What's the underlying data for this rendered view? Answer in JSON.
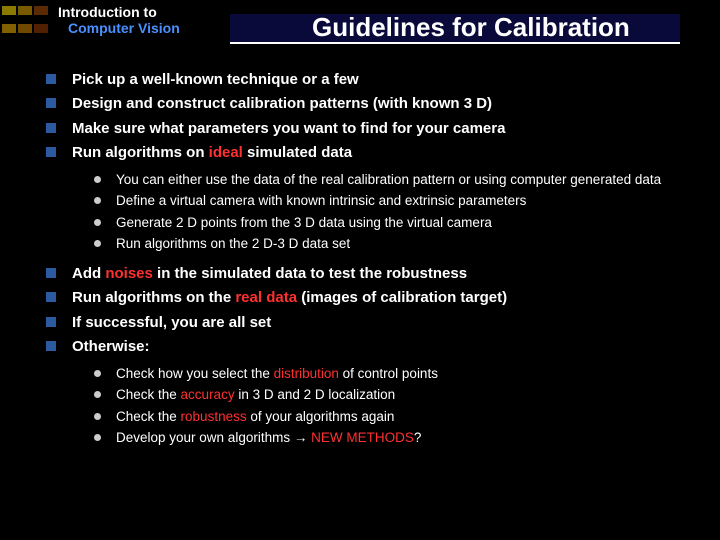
{
  "header": {
    "intro_line1": "Introduction to",
    "intro_line2": "Computer Vision",
    "title": "Guidelines for Calibration"
  },
  "bullets1": [
    {
      "pre": "Pick up a well-known technique or a few"
    },
    {
      "pre": "Design and construct calibration patterns (with known 3 D)"
    },
    {
      "pre": "Make sure what parameters you want to find for your camera"
    },
    {
      "pre": "Run algorithms on ",
      "red": "ideal",
      "post": " simulated data"
    }
  ],
  "sub1": [
    "You can either use the data of the real calibration pattern or using computer generated data",
    "Define a virtual camera with known intrinsic and extrinsic parameters",
    "Generate 2 D points from the 3 D data using the virtual camera",
    "Run algorithms on the 2 D-3 D data set"
  ],
  "bullets2": [
    {
      "pre": "Add ",
      "red": "noises",
      "post": " in the simulated data to test the robustness"
    },
    {
      "pre": "Run algorithms on the ",
      "red": "real data",
      "post": " (images of calibration target)"
    },
    {
      "pre": "If successful, you are all set"
    },
    {
      "pre": "Otherwise:"
    }
  ],
  "sub2": [
    {
      "pre": "Check how you select the ",
      "red": "distribution",
      "post": "  of control points"
    },
    {
      "pre": "Check the ",
      "red": "accuracy",
      "post": " in 3 D and 2 D localization"
    },
    {
      "pre": "Check the ",
      "red": "robustness",
      "post": " of your algorithms again"
    },
    {
      "pre": "Develop your own algorithms ",
      "arrow": "→ ",
      "red": "NEW METHODS",
      "post": "?"
    }
  ]
}
